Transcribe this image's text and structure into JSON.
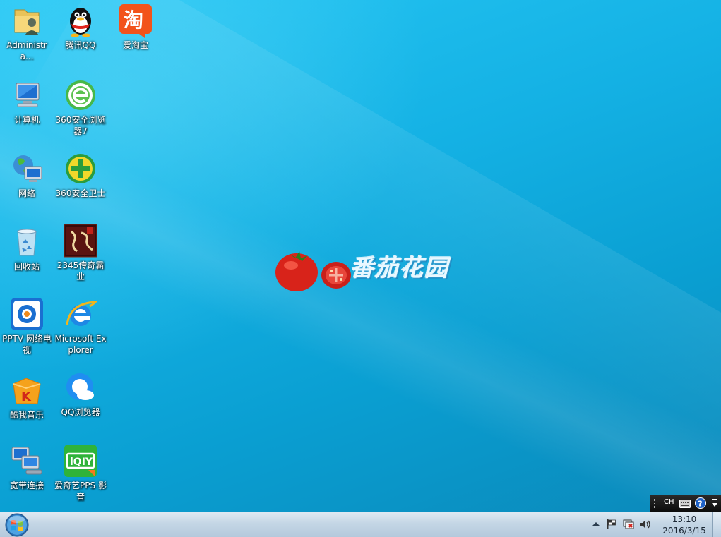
{
  "desktop": {
    "icons": [
      {
        "label": "Administra..."
      },
      {
        "label": "腾讯QQ"
      },
      {
        "label": "爱淘宝"
      },
      {
        "label": "计算机"
      },
      {
        "label": "360安全浏览器7"
      },
      {
        "label": "网络"
      },
      {
        "label": "360安全卫士"
      },
      {
        "label": "回收站"
      },
      {
        "label": "2345传奇霸业"
      },
      {
        "label": "PPTV 网络电视"
      },
      {
        "label": "Microsoft Explorer"
      },
      {
        "label": "酷我音乐"
      },
      {
        "label": "QQ浏览器"
      },
      {
        "label": "宽带连接"
      },
      {
        "label": "爱奇艺PPS 影音"
      }
    ]
  },
  "wallpaper": {
    "logo_text": "番茄花园",
    "colors": {
      "sky_light": "#27c7f4",
      "sky_dark": "#0b87b8",
      "tomato": "#d8231a"
    }
  },
  "langbar": {
    "lang_code": "CH"
  },
  "taskbar": {
    "start_icon": "windows-orb-icon",
    "tray_icons": [
      "show-hidden-icons-icon",
      "action-center-flag-icon",
      "network-icon",
      "volume-icon"
    ],
    "clock_time": "13:10",
    "clock_date": "2016/3/15"
  }
}
